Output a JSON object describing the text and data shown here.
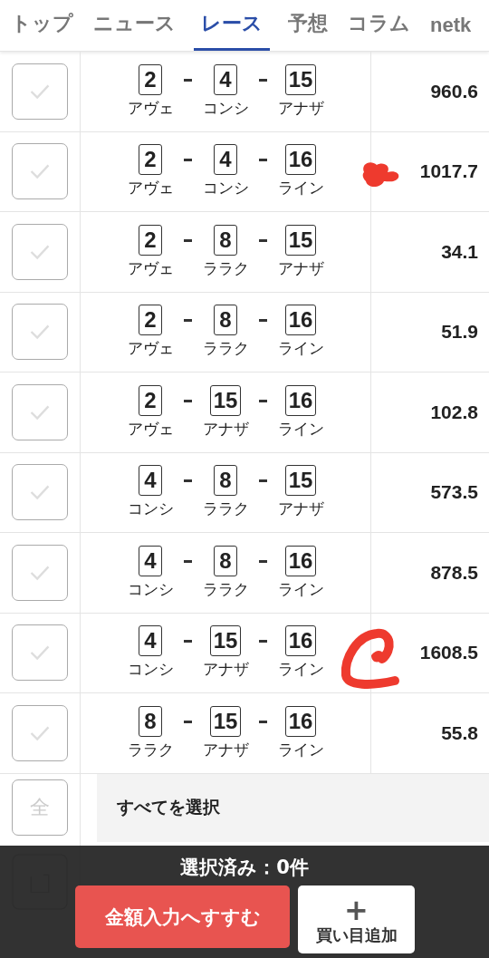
{
  "tabs": [
    {
      "label": "トップ",
      "selected": false
    },
    {
      "label": "ニュース",
      "selected": false
    },
    {
      "label": "レース",
      "selected": true
    },
    {
      "label": "予想",
      "selected": false
    },
    {
      "label": "コラム",
      "selected": false
    },
    {
      "label": "netk",
      "selected": false
    }
  ],
  "rows": [
    {
      "checked": false,
      "horses": [
        {
          "num": "2",
          "name": "アヴェ"
        },
        {
          "num": "4",
          "name": "コンシ"
        },
        {
          "num": "15",
          "name": "アナザ"
        }
      ],
      "odds": "960.6"
    },
    {
      "checked": false,
      "horses": [
        {
          "num": "2",
          "name": "アヴェ"
        },
        {
          "num": "4",
          "name": "コンシ"
        },
        {
          "num": "16",
          "name": "ライン"
        }
      ],
      "odds": "1017.7",
      "kind": "heart"
    },
    {
      "checked": false,
      "horses": [
        {
          "num": "2",
          "name": "アヴェ"
        },
        {
          "num": "8",
          "name": "ララク"
        },
        {
          "num": "15",
          "name": "アナザ"
        }
      ],
      "odds": "34.1"
    },
    {
      "checked": false,
      "horses": [
        {
          "num": "2",
          "name": "アヴェ"
        },
        {
          "num": "8",
          "name": "ララク"
        },
        {
          "num": "16",
          "name": "ライン"
        }
      ],
      "odds": "51.9"
    },
    {
      "checked": false,
      "horses": [
        {
          "num": "2",
          "name": "アヴェ"
        },
        {
          "num": "15",
          "name": "アナザ"
        },
        {
          "num": "16",
          "name": "ライン"
        }
      ],
      "odds": "102.8"
    },
    {
      "checked": false,
      "horses": [
        {
          "num": "4",
          "name": "コンシ"
        },
        {
          "num": "8",
          "name": "ララク"
        },
        {
          "num": "15",
          "name": "アナザ"
        }
      ],
      "odds": "573.5"
    },
    {
      "checked": false,
      "horses": [
        {
          "num": "4",
          "name": "コンシ"
        },
        {
          "num": "8",
          "name": "ララク"
        },
        {
          "num": "16",
          "name": "ライン"
        }
      ],
      "odds": "878.5"
    },
    {
      "checked": false,
      "horses": [
        {
          "num": "4",
          "name": "コンシ"
        },
        {
          "num": "15",
          "name": "アナザ"
        },
        {
          "num": "16",
          "name": "ライン"
        }
      ],
      "odds": "1608.5",
      "kind": "circle"
    },
    {
      "checked": false,
      "horses": [
        {
          "num": "8",
          "name": "ララク"
        },
        {
          "num": "15",
          "name": "アナザ"
        },
        {
          "num": "16",
          "name": "ライン"
        }
      ],
      "odds": "55.8"
    }
  ],
  "select_all": {
    "icon": "全",
    "label": "すべてを選択"
  },
  "bottom_bar": {
    "selected_count": "選択済み：0件",
    "proceed_button": "金額入力へすすむ",
    "add_button": {
      "icon": "+",
      "label": "買い目追加"
    }
  }
}
